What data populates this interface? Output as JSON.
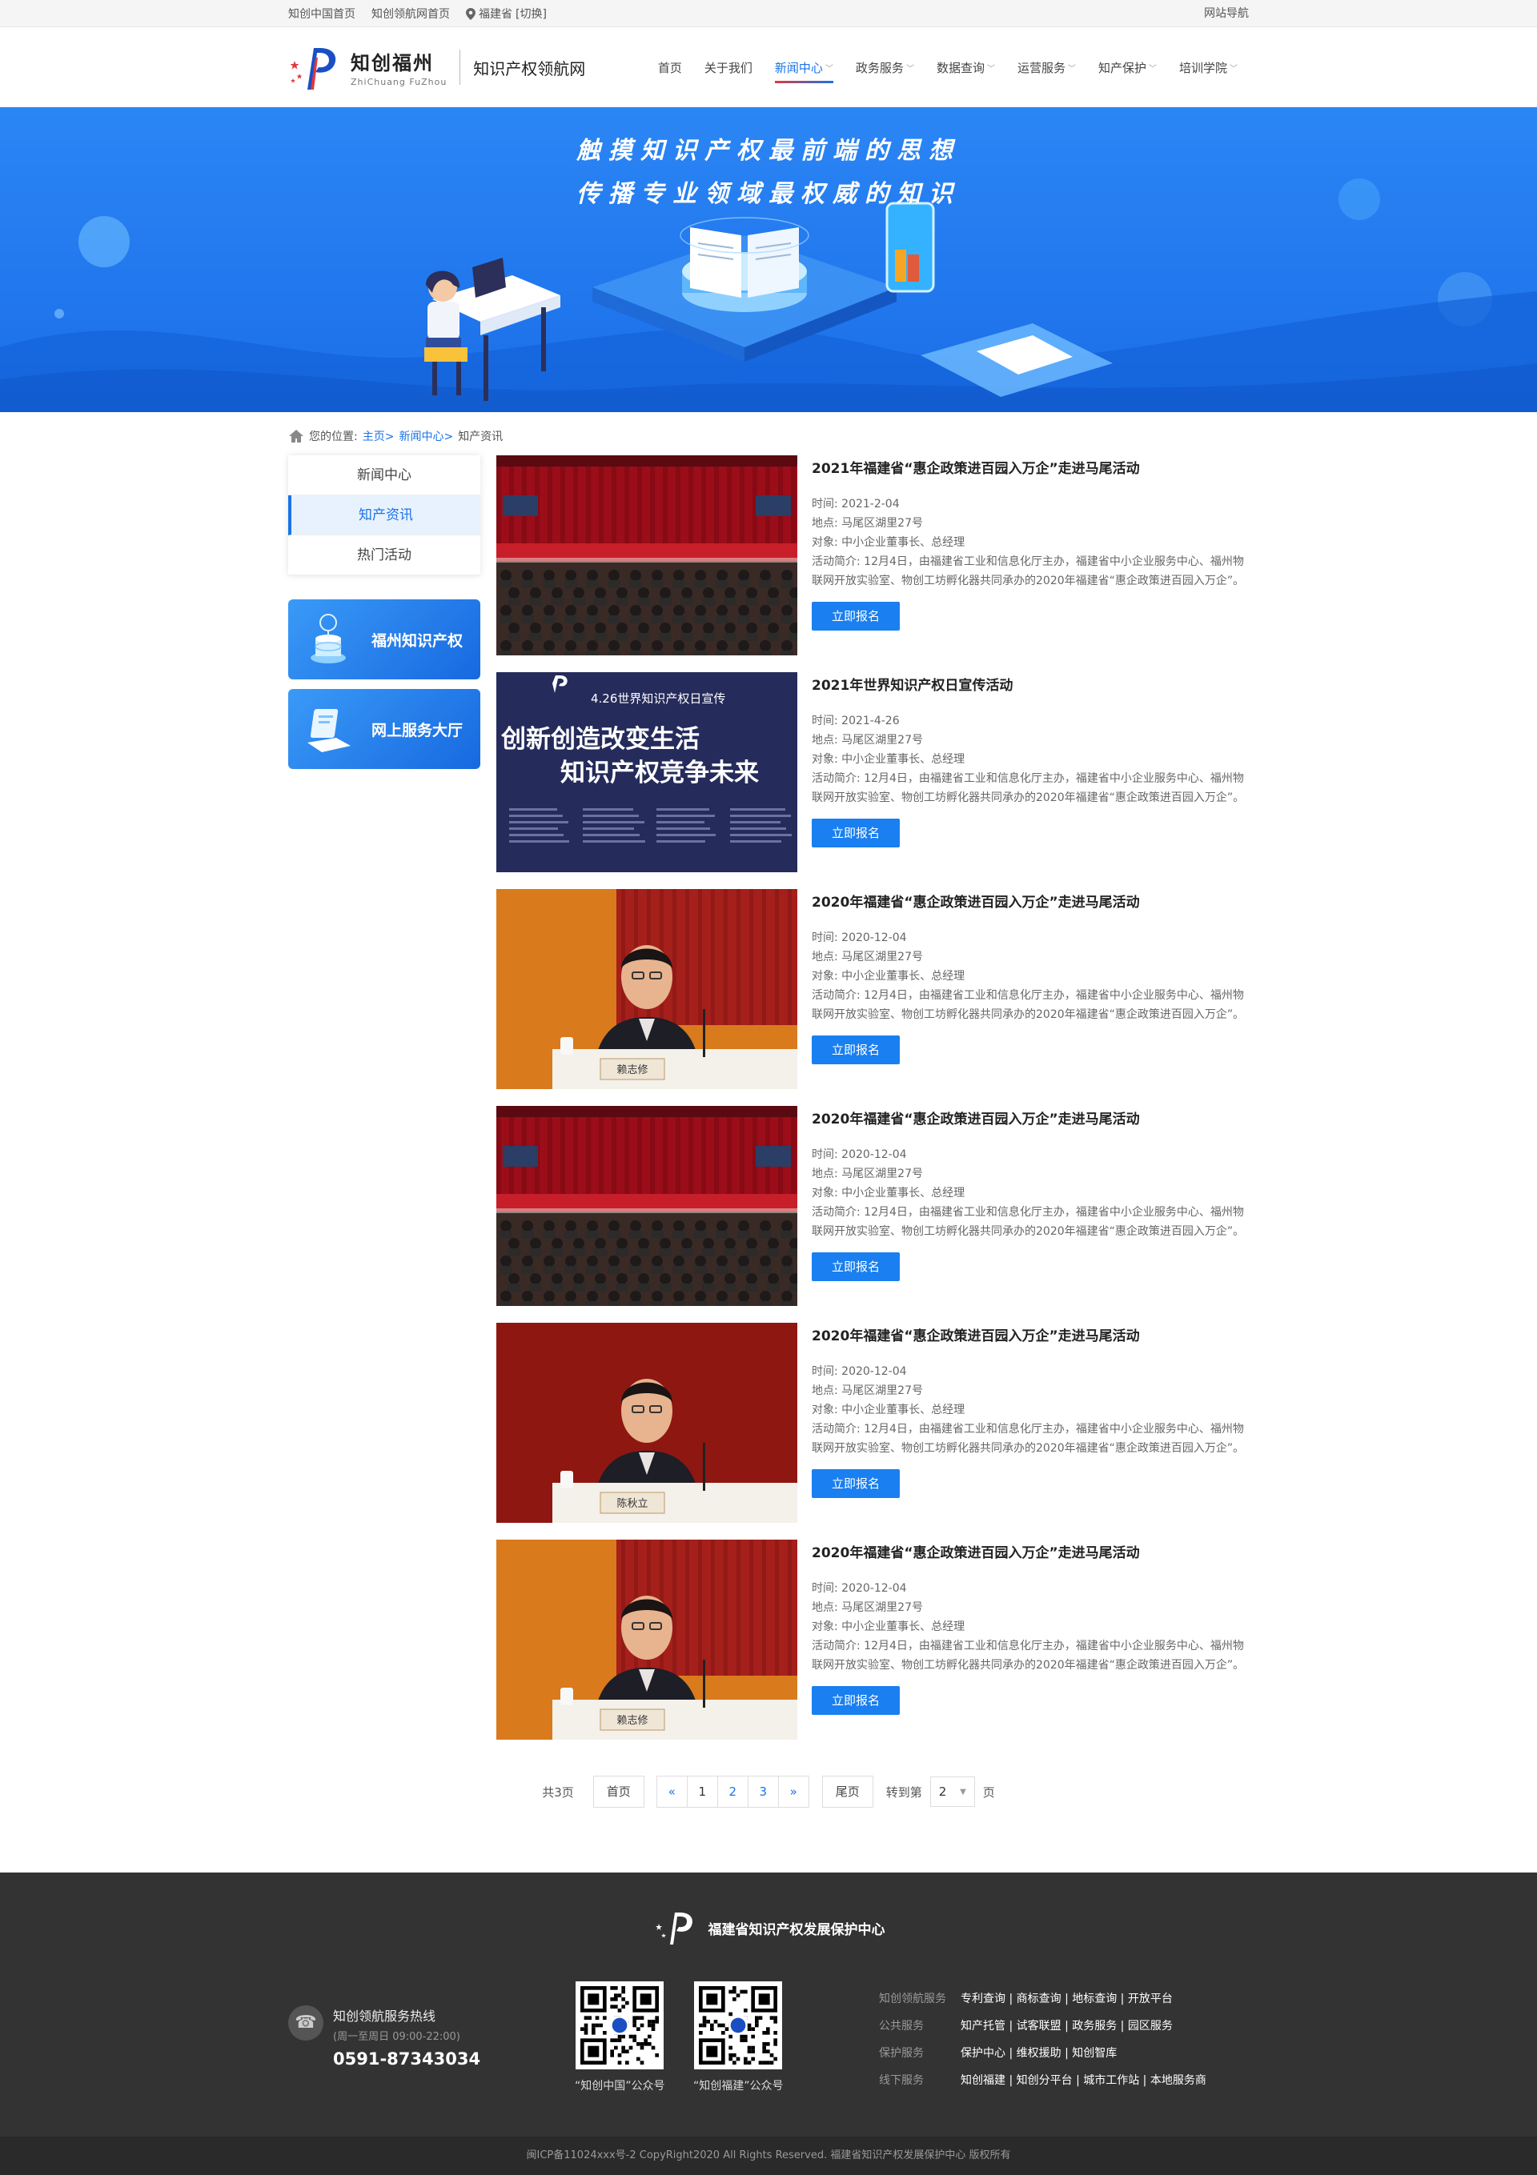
{
  "topbar": {
    "links": [
      "知创中国首页",
      "知创领航网首页"
    ],
    "location": "福建省",
    "switch": "[切换]",
    "site_nav": "网站导航"
  },
  "header": {
    "logo_name": "知创福州",
    "logo_en": "ZhiChuang FuZhou",
    "logo_sub": "知识产权领航网",
    "nav": [
      {
        "label": "首页",
        "dropdown": false
      },
      {
        "label": "关于我们",
        "dropdown": false
      },
      {
        "label": "新闻中心",
        "dropdown": true,
        "active": true
      },
      {
        "label": "政务服务",
        "dropdown": true
      },
      {
        "label": "数据查询",
        "dropdown": true
      },
      {
        "label": "运营服务",
        "dropdown": true
      },
      {
        "label": "知产保护",
        "dropdown": true
      },
      {
        "label": "培训学院",
        "dropdown": true
      }
    ]
  },
  "banner": {
    "line1": "触摸知识产权最前端的思想",
    "line2": "传播专业领域最权威的知识"
  },
  "breadcrumb": {
    "prefix": "您的位置:",
    "home": "主页>",
    "news": "新闻中心>",
    "current": "知产资讯"
  },
  "sidebar": {
    "menu": [
      "新闻中心",
      "知产资讯",
      "热门活动"
    ],
    "active_index": 1,
    "cards": [
      "福州知识产权",
      "网上服务大厅"
    ]
  },
  "list": [
    {
      "title": "2021年福建省“惠企政策进百园入万企”走进马尾活动",
      "time": "时间:  2021-2-04",
      "place": "地点:  马尾区湖里27号",
      "target": "对象:  中小企业董事长、总经理",
      "intro": "活动简介:  12月4日，由福建省工业和信息化厅主办，福建省中小企业服务中心、福州物联网开放实验室、物创工坊孵化器共同承办的2020年福建省“惠企政策进百园入万企”。",
      "button": "立即报名",
      "photo": "hall"
    },
    {
      "title": "2021年世界知识产权日宣传活动",
      "time": "时间:  2021-4-26",
      "place": "地点:  马尾区湖里27号",
      "target": "对象:  中小企业董事长、总经理",
      "intro": "活动简介:  12月4日，由福建省工业和信息化厅主办，福建省中小企业服务中心、福州物联网开放实验室、物创工坊孵化器共同承办的2020年福建省“惠企政策进百园入万企”。",
      "button": "立即报名",
      "photo": "poster",
      "poster_title": "4.26世界知识产权日宣传",
      "poster_line1": "创新创造改变生活",
      "poster_line2": "知识产权竞争未来"
    },
    {
      "title": "2020年福建省“惠企政策进百园入万企”走进马尾活动",
      "time": "时间:  2020-12-04",
      "place": "地点:  马尾区湖里27号",
      "target": "对象:  中小企业董事长、总经理",
      "intro": "活动简介:  12月4日，由福建省工业和信息化厅主办，福建省中小企业服务中心、福州物联网开放实验室、物创工坊孵化器共同承办的2020年福建省“惠企政策进百园入万企”。",
      "button": "立即报名",
      "photo": "speaker-orange",
      "nameplate": "赖志修"
    },
    {
      "title": "2020年福建省“惠企政策进百园入万企”走进马尾活动",
      "time": "时间:  2020-12-04",
      "place": "地点:  马尾区湖里27号",
      "target": "对象:  中小企业董事长、总经理",
      "intro": "活动简介:  12月4日，由福建省工业和信息化厅主办，福建省中小企业服务中心、福州物联网开放实验室、物创工坊孵化器共同承办的2020年福建省“惠企政策进百园入万企”。",
      "button": "立即报名",
      "photo": "hall"
    },
    {
      "title": "2020年福建省“惠企政策进百园入万企”走进马尾活动",
      "time": "时间:  2020-12-04",
      "place": "地点:  马尾区湖里27号",
      "target": "对象:  中小企业董事长、总经理",
      "intro": "活动简介:  12月4日，由福建省工业和信息化厅主办，福建省中小企业服务中心、福州物联网开放实验室、物创工坊孵化器共同承办的2020年福建省“惠企政策进百园入万企”。",
      "button": "立即报名",
      "photo": "speaker-red",
      "nameplate": "陈秋立"
    },
    {
      "title": "2020年福建省“惠企政策进百园入万企”走进马尾活动",
      "time": "时间:  2020-12-04",
      "place": "地点:  马尾区湖里27号",
      "target": "对象:  中小企业董事长、总经理",
      "intro": "活动简介:  12月4日，由福建省工业和信息化厅主办，福建省中小企业服务中心、福州物联网开放实验室、物创工坊孵化器共同承办的2020年福建省“惠企政策进百园入万企”。",
      "button": "立即报名",
      "photo": "speaker-orange",
      "nameplate": "赖志修"
    }
  ],
  "pager": {
    "total": "共3页",
    "first": "首页",
    "prev": "«",
    "pages": [
      "1",
      "2",
      "3"
    ],
    "next": "»",
    "last": "尾页",
    "goto": "转到第",
    "goto_value": "2",
    "unit": "页"
  },
  "footer": {
    "org": "福建省知识产权发展保护中心",
    "hotline_title": "知创领航服务热线",
    "hotline_hours": "(周一至周日 09:00-22:00)",
    "hotline_number": "0591-87343034",
    "qr1": "“知创中国”公众号",
    "qr2": "“知创福建”公众号",
    "links": [
      {
        "label": "知创领航服务",
        "items": "专利查询 | 商标查询 | 地标查询 | 开放平台"
      },
      {
        "label": "公共服务",
        "items": "知产托管 | 试客联盟 | 政务服务 | 园区服务"
      },
      {
        "label": "保护服务",
        "items": "保护中心 | 维权援助 | 知创智库"
      },
      {
        "label": "线下服务",
        "items": "知创福建 | 知创分平台 | 城市工作站 | 本地服务商"
      }
    ],
    "copyright": "闽ICP备11024xxx号-2  CopyRight2020  All Rights Reserved.  福建省知识产权发展保护中心  版权所有"
  }
}
